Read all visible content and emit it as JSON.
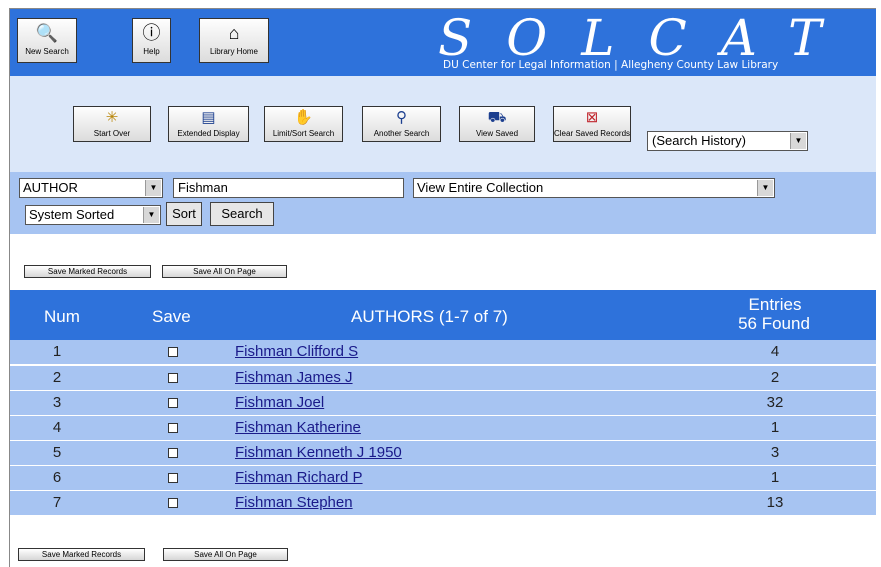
{
  "header": {
    "buttons": [
      {
        "label": "New Search",
        "icon": "new-search-icon"
      },
      {
        "label": "Help",
        "icon": "help-icon"
      },
      {
        "label": "Library Home",
        "icon": "home-icon"
      }
    ],
    "logo": "SOLCAT",
    "subtitle": "DU Center for Legal Information | Allegheny County Law Library"
  },
  "toolbar": {
    "buttons": [
      {
        "label": "Start Over",
        "icon": "start-over-icon"
      },
      {
        "label": "Extended Display",
        "icon": "extended-display-icon"
      },
      {
        "label": "Limit/Sort Search",
        "icon": "limit-sort-icon"
      },
      {
        "label": "Another Search",
        "icon": "another-search-icon"
      },
      {
        "label": "View Saved",
        "icon": "cart-icon"
      },
      {
        "label": "Clear Saved Records",
        "icon": "clear-records-icon"
      }
    ],
    "history_select": "(Search History)"
  },
  "search": {
    "field_select": "AUTHOR",
    "query": "Fishman",
    "collection_select": "View Entire Collection",
    "sort_select": "System Sorted",
    "sort_button": "Sort",
    "search_button": "Search"
  },
  "actions": {
    "save_marked": "Save Marked Records",
    "save_all": "Save All On Page"
  },
  "table": {
    "col_num": "Num",
    "col_save": "Save",
    "col_authors": "AUTHORS (1-7 of 7)",
    "col_entries": "Entries",
    "entries_found": "56 Found",
    "rows": [
      {
        "num": "1",
        "name": "Fishman Clifford S",
        "count": "4"
      },
      {
        "num": "2",
        "name": "Fishman James J",
        "count": "2"
      },
      {
        "num": "3",
        "name": "Fishman Joel",
        "count": "32"
      },
      {
        "num": "4",
        "name": "Fishman Katherine",
        "count": "1"
      },
      {
        "num": "5",
        "name": "Fishman Kenneth J 1950",
        "count": "3"
      },
      {
        "num": "6",
        "name": "Fishman Richard P",
        "count": "1"
      },
      {
        "num": "7",
        "name": "Fishman Stephen",
        "count": "13"
      }
    ]
  }
}
